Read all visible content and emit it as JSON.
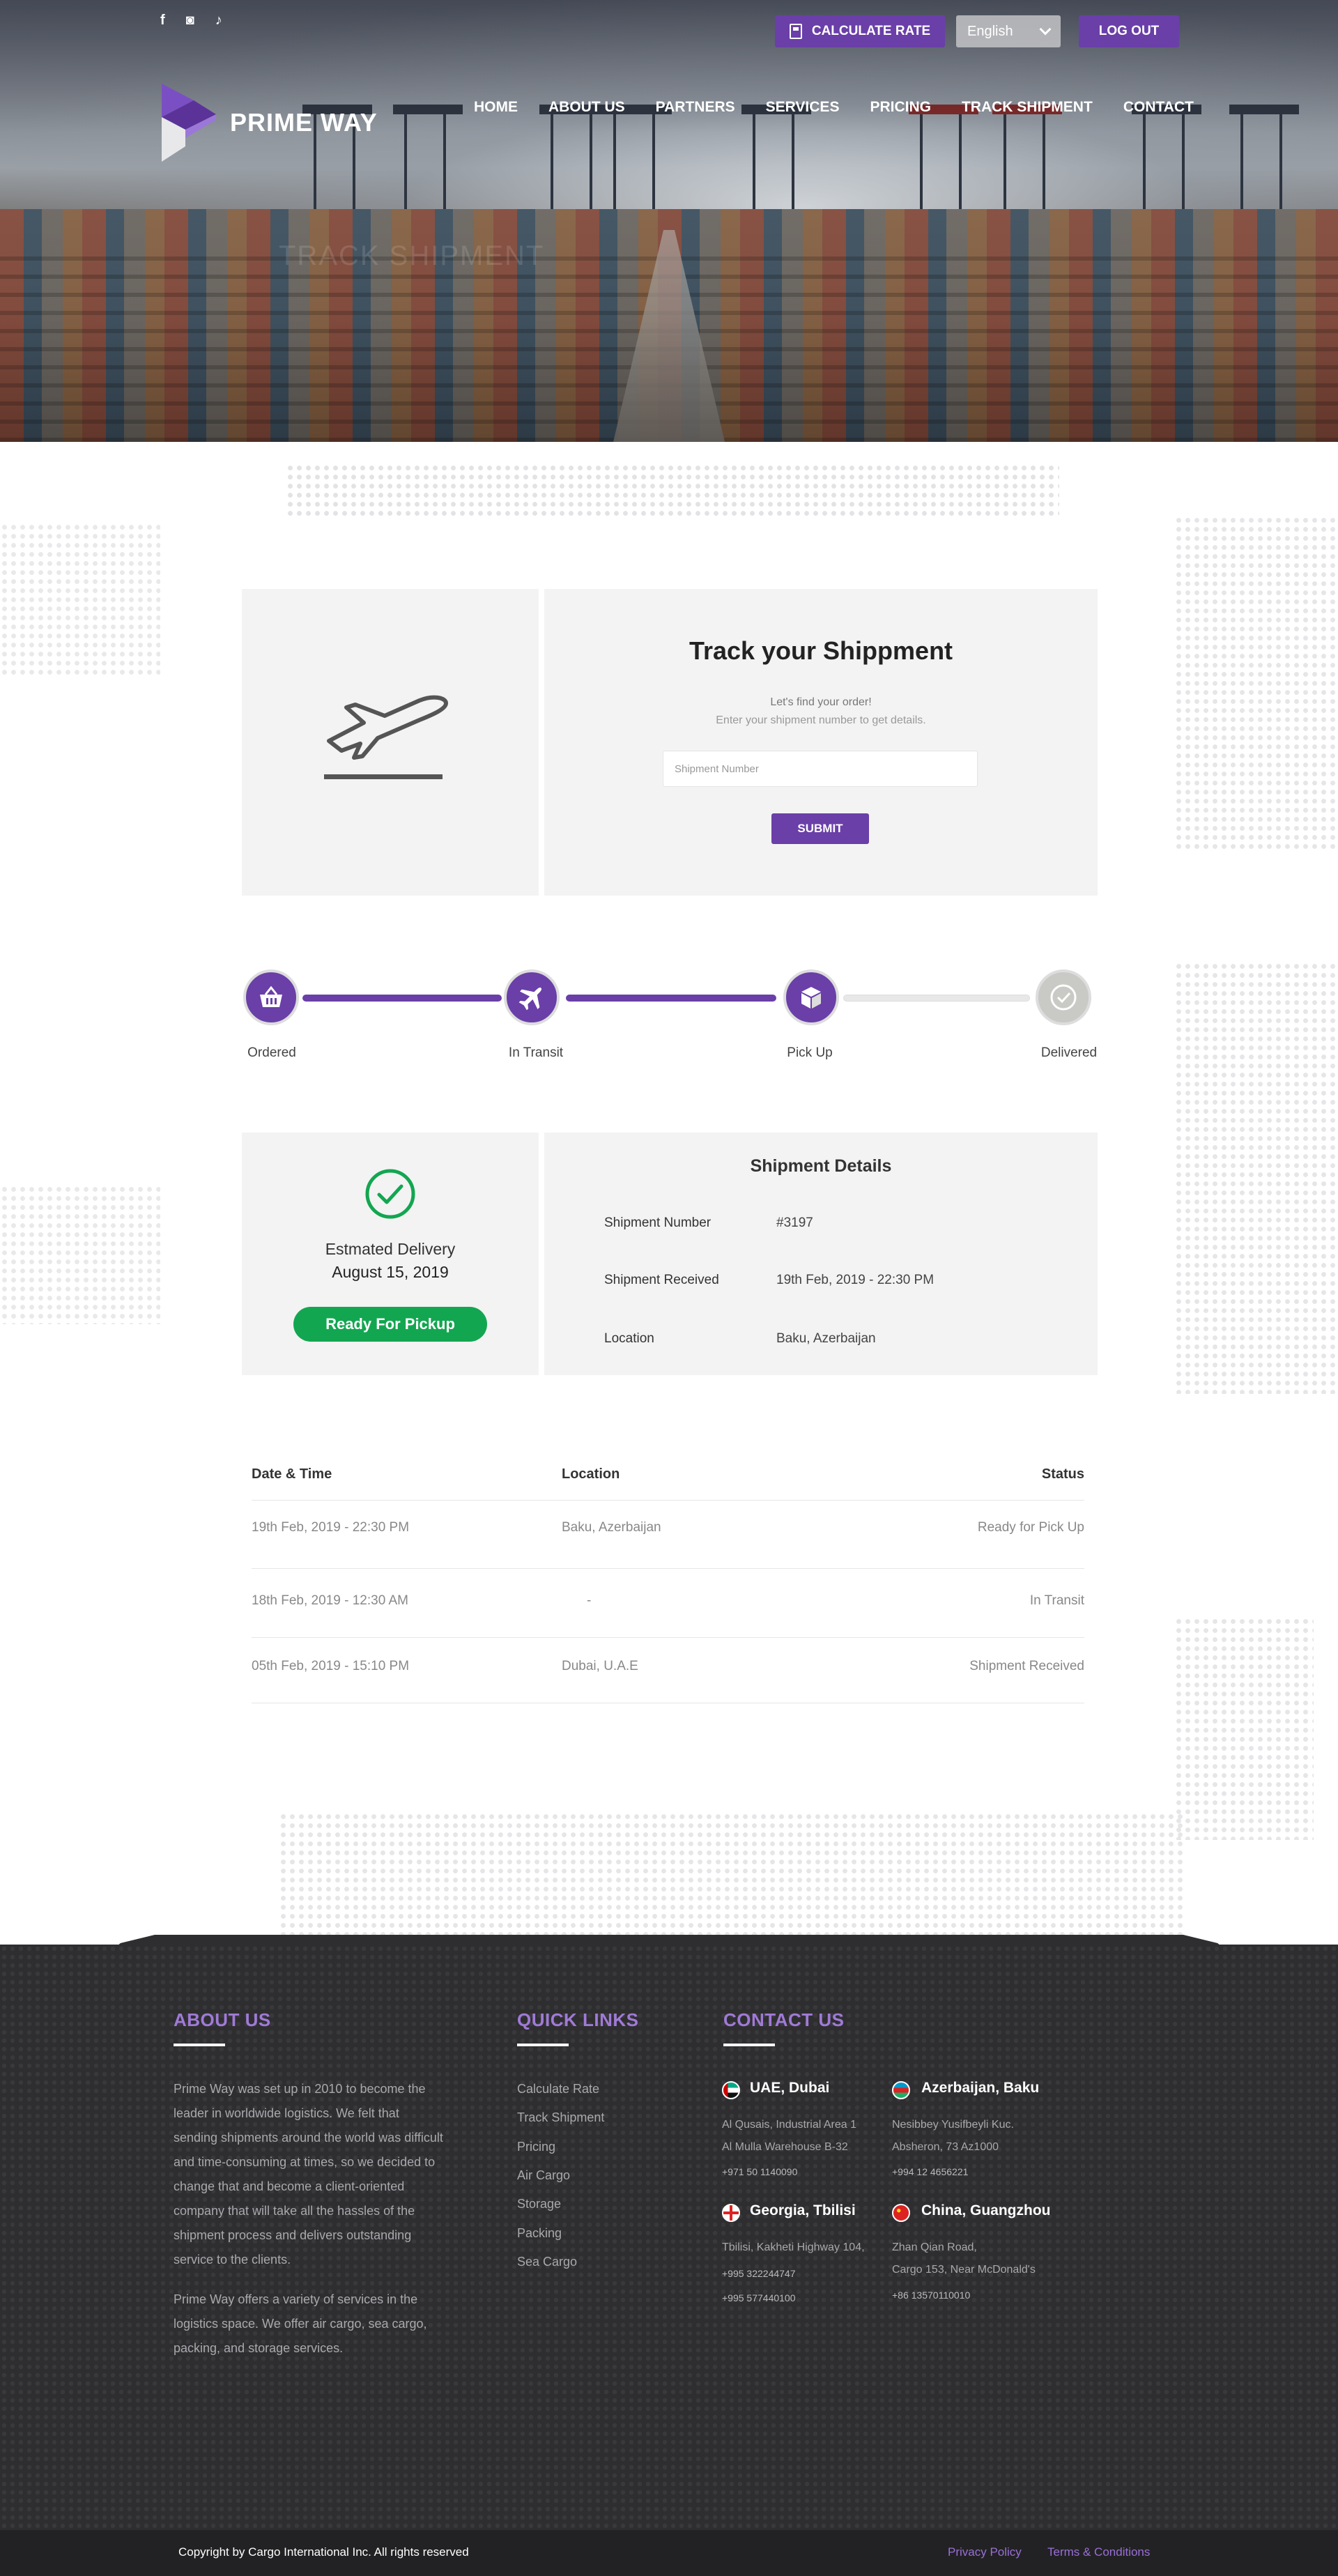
{
  "header": {
    "social": [
      {
        "icon": "facebook-icon",
        "glyph": "f"
      },
      {
        "icon": "instagram-icon",
        "glyph": "◙"
      },
      {
        "icon": "twitter-icon",
        "glyph": "♪"
      }
    ],
    "calculate_rate": "CALCULATE RATE",
    "language": "English",
    "logout": "LOG OUT",
    "brand": "PRIME WAY",
    "hero_ghost": "TRACK SHIPMENT",
    "nav": [
      "HOME",
      "ABOUT US",
      "PARTNERS",
      "SERVICES",
      "PRICING",
      "TRACK SHIPMENT",
      "CONTACT"
    ]
  },
  "track": {
    "title": "Track your Shippment",
    "subtitle": "Let's find your order!",
    "hint": "Enter your shipment number to get details.",
    "placeholder": "Shipment Number",
    "submit": "SUBMIT"
  },
  "progress": {
    "steps": [
      {
        "label": "Ordered",
        "state": "done",
        "icon": "basket-icon"
      },
      {
        "label": "In Transit",
        "state": "done",
        "icon": "airplane-icon"
      },
      {
        "label": "Pick Up",
        "state": "done",
        "icon": "package-icon"
      },
      {
        "label": "Delivered",
        "state": "pending",
        "icon": "check-icon"
      }
    ]
  },
  "delivery": {
    "label": "Estmated Delivery",
    "date": "August 15, 2019",
    "status_button": "Ready For Pickup",
    "status_color": "#13a651"
  },
  "details": {
    "title": "Shipment Details",
    "rows": [
      {
        "label": "Shipment Number",
        "value": "#3197"
      },
      {
        "label": "Shipment Received",
        "value": "19th Feb, 2019  - 22:30 PM"
      },
      {
        "label": "Location",
        "value": "Baku,  Azerbaijan"
      }
    ]
  },
  "history": {
    "columns": [
      "Date & Time",
      "Location",
      "Status"
    ],
    "rows": [
      {
        "datetime": "19th Feb, 2019  - 22:30 PM",
        "location": "Baku,  Azerbaijan",
        "status": "Ready for Pick Up"
      },
      {
        "datetime": "18th Feb, 2019  - 12:30 AM",
        "location": "-",
        "status": "In Transit"
      },
      {
        "datetime": "05th Feb, 2019  - 15:10 PM",
        "location": "Dubai, U.A.E",
        "status": "Shipment Received"
      }
    ]
  },
  "footer": {
    "about_title": "ABOUT US",
    "about_p1_lines": [
      "Prime Way was set up in 2010 to become the",
      "leader in worldwide logistics. We felt that",
      "sending shipments around the world was difficult",
      "and time-consuming at times, so we decided to",
      "change that and become a client-oriented",
      "company that will take all the hassles of the",
      "shipment process and delivers outstanding",
      "service to the clients."
    ],
    "about_p2_lines": [
      "Prime Way offers a variety of services in the",
      "logistics space. We offer air cargo, sea cargo,",
      "packing, and storage services."
    ],
    "links_title": "QUICK LINKS",
    "links": [
      "Calculate Rate",
      "Track Shipment",
      "Pricing",
      "Air Cargo",
      "Storage",
      "Packing",
      "Sea Cargo"
    ],
    "contact_title": "CONTACT US",
    "offices": [
      {
        "name": "UAE, Dubai",
        "flag": "uae-flag-icon",
        "lines": [
          "Al Qusais, Industrial Area 1",
          "Al Mulla Warehouse B-32"
        ],
        "phones": [
          "+971 50 1140090"
        ]
      },
      {
        "name": "Azerbaijan, Baku",
        "flag": "azerbaijan-flag-icon",
        "lines": [
          "Nesibbey Yusifbeyli Kuc.",
          "Absheron, 73 Az1000"
        ],
        "phones": [
          "+994 12 4656221"
        ]
      },
      {
        "name": "Georgia, Tbilisi",
        "flag": "georgia-flag-icon",
        "lines": [
          "Tbilisi, Kakheti Highway 104,"
        ],
        "phones": [
          "+995 322244747",
          "+995 577440100"
        ]
      },
      {
        "name": "China, Guangzhou",
        "flag": "china-flag-icon",
        "lines": [
          "Zhan Qian Road,",
          "Cargo 153, Near McDonald's"
        ],
        "phones": [
          "+86 13570110010"
        ]
      }
    ],
    "copyright": "Copyright by Cargo International Inc. All rights reserved",
    "privacy": "Privacy Policy",
    "terms": "Terms & Conditions"
  },
  "colors": {
    "brand_purple": "#6a3fa8",
    "footer_heading": "#a07ad6",
    "success_green": "#13a651",
    "footer_bg": "#2e2e30"
  }
}
